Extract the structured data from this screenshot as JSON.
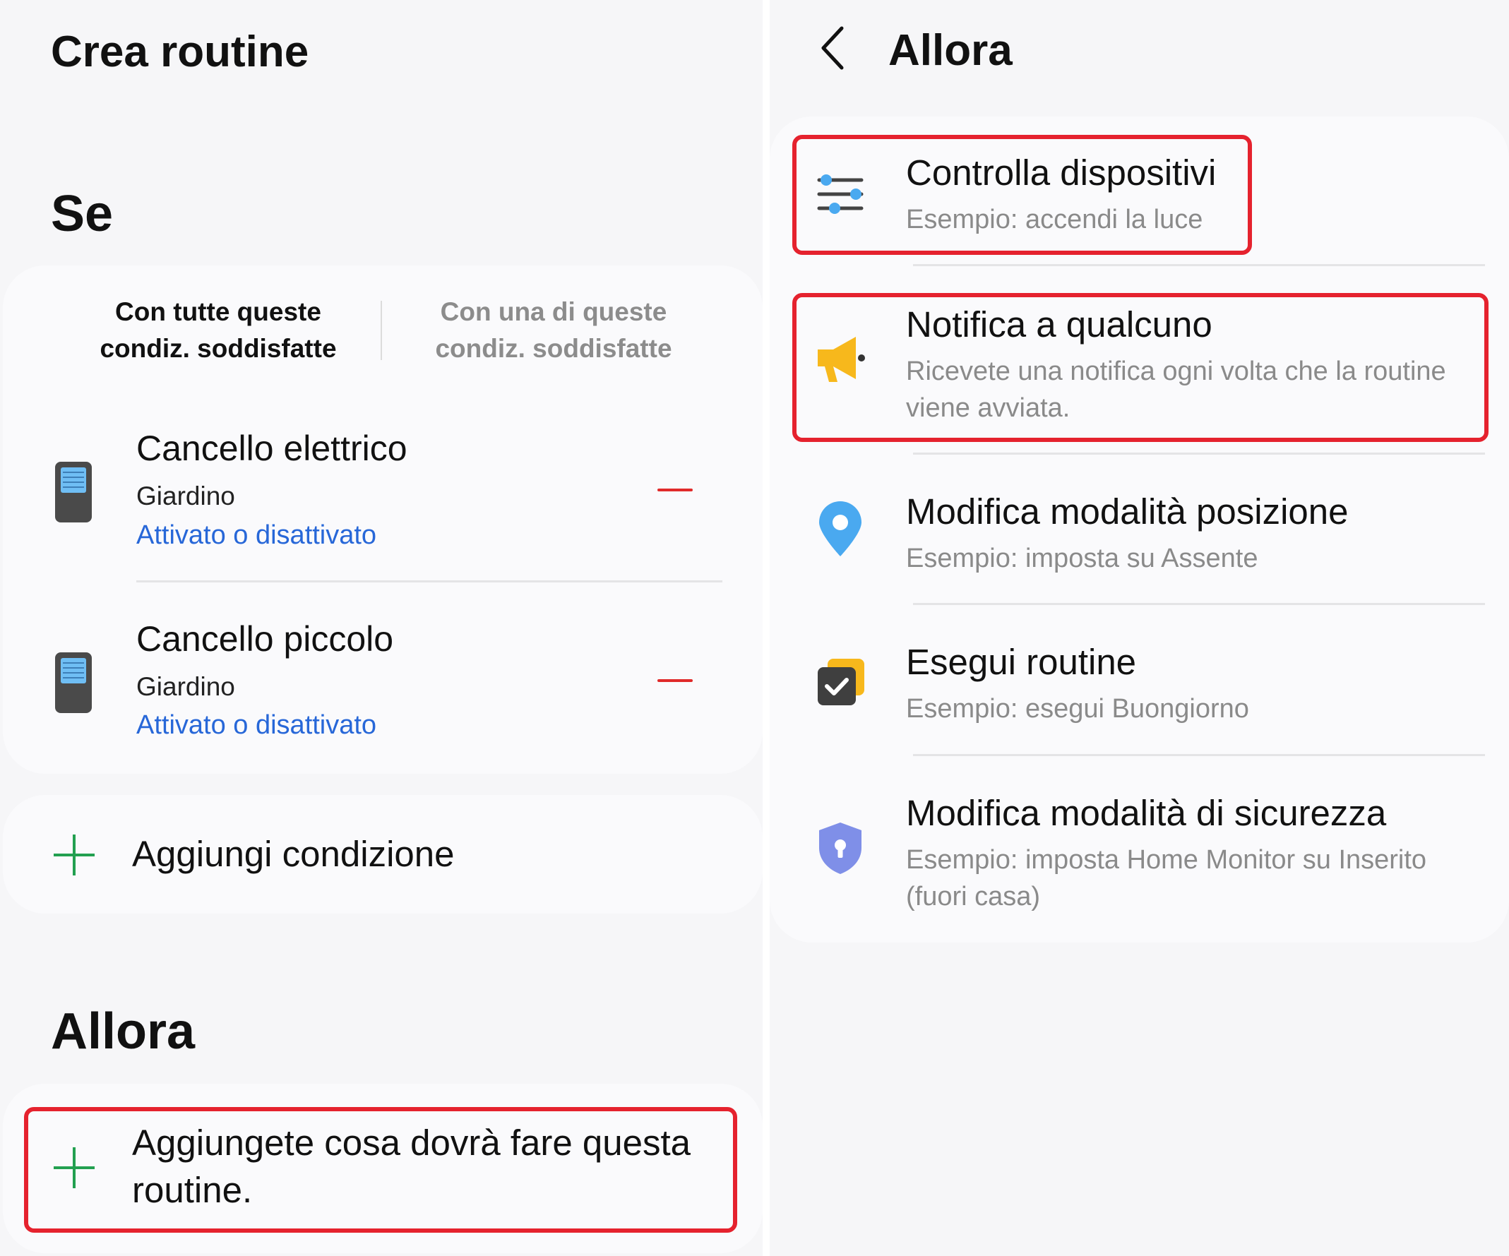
{
  "left": {
    "app_title": "Crea routine",
    "if_section": {
      "title": "Se",
      "segments": [
        {
          "line1": "Con tutte queste",
          "line2": "condiz. soddisfatte",
          "selected": true
        },
        {
          "line1": "Con una di queste",
          "line2": "condiz. soddisfatte",
          "selected": false
        }
      ],
      "conditions": [
        {
          "icon": "device-icon",
          "name": "Cancello elettrico",
          "room": "Giardino",
          "state": "Attivato o disattivato"
        },
        {
          "icon": "device-icon",
          "name": "Cancello piccolo",
          "room": "Giardino",
          "state": "Attivato o disattivato"
        }
      ],
      "add_condition_label": "Aggiungi condizione"
    },
    "then_section": {
      "title": "Allora",
      "add_action_line1": "Aggiungete cosa dovrà fare questa",
      "add_action_line2": "routine."
    }
  },
  "right": {
    "title": "Allora",
    "options": [
      {
        "icon": "sliders-icon",
        "title": "Controlla dispositivi",
        "sub1": "Esempio: accendi la luce",
        "sub2": ""
      },
      {
        "icon": "megaphone-icon",
        "title": "Notifica a qualcuno",
        "sub1": "Ricevete una notifica ogni volta che la routine",
        "sub2": "viene avviata."
      },
      {
        "icon": "location-pin-icon",
        "title": "Modifica modalità posizione",
        "sub1": "Esempio: imposta su Assente",
        "sub2": ""
      },
      {
        "icon": "routine-check-icon",
        "title": "Esegui routine",
        "sub1": "Esempio: esegui Buongiorno",
        "sub2": ""
      },
      {
        "icon": "security-shield-icon",
        "title": "Modifica modalità di sicurezza",
        "sub1": "Esempio: imposta Home Monitor su Inserito",
        "sub2": "(fuori casa)"
      }
    ]
  },
  "colors": {
    "background": "#f6f6f8",
    "card": "#fafafc",
    "highlight_red": "#e5222e",
    "link_blue": "#2767d8",
    "remove_red": "#e02a2a",
    "add_green": "#22a050",
    "icon_blue": "#4aa9f0",
    "icon_yellow": "#f7b81c",
    "icon_purple": "#7f8fe8"
  }
}
